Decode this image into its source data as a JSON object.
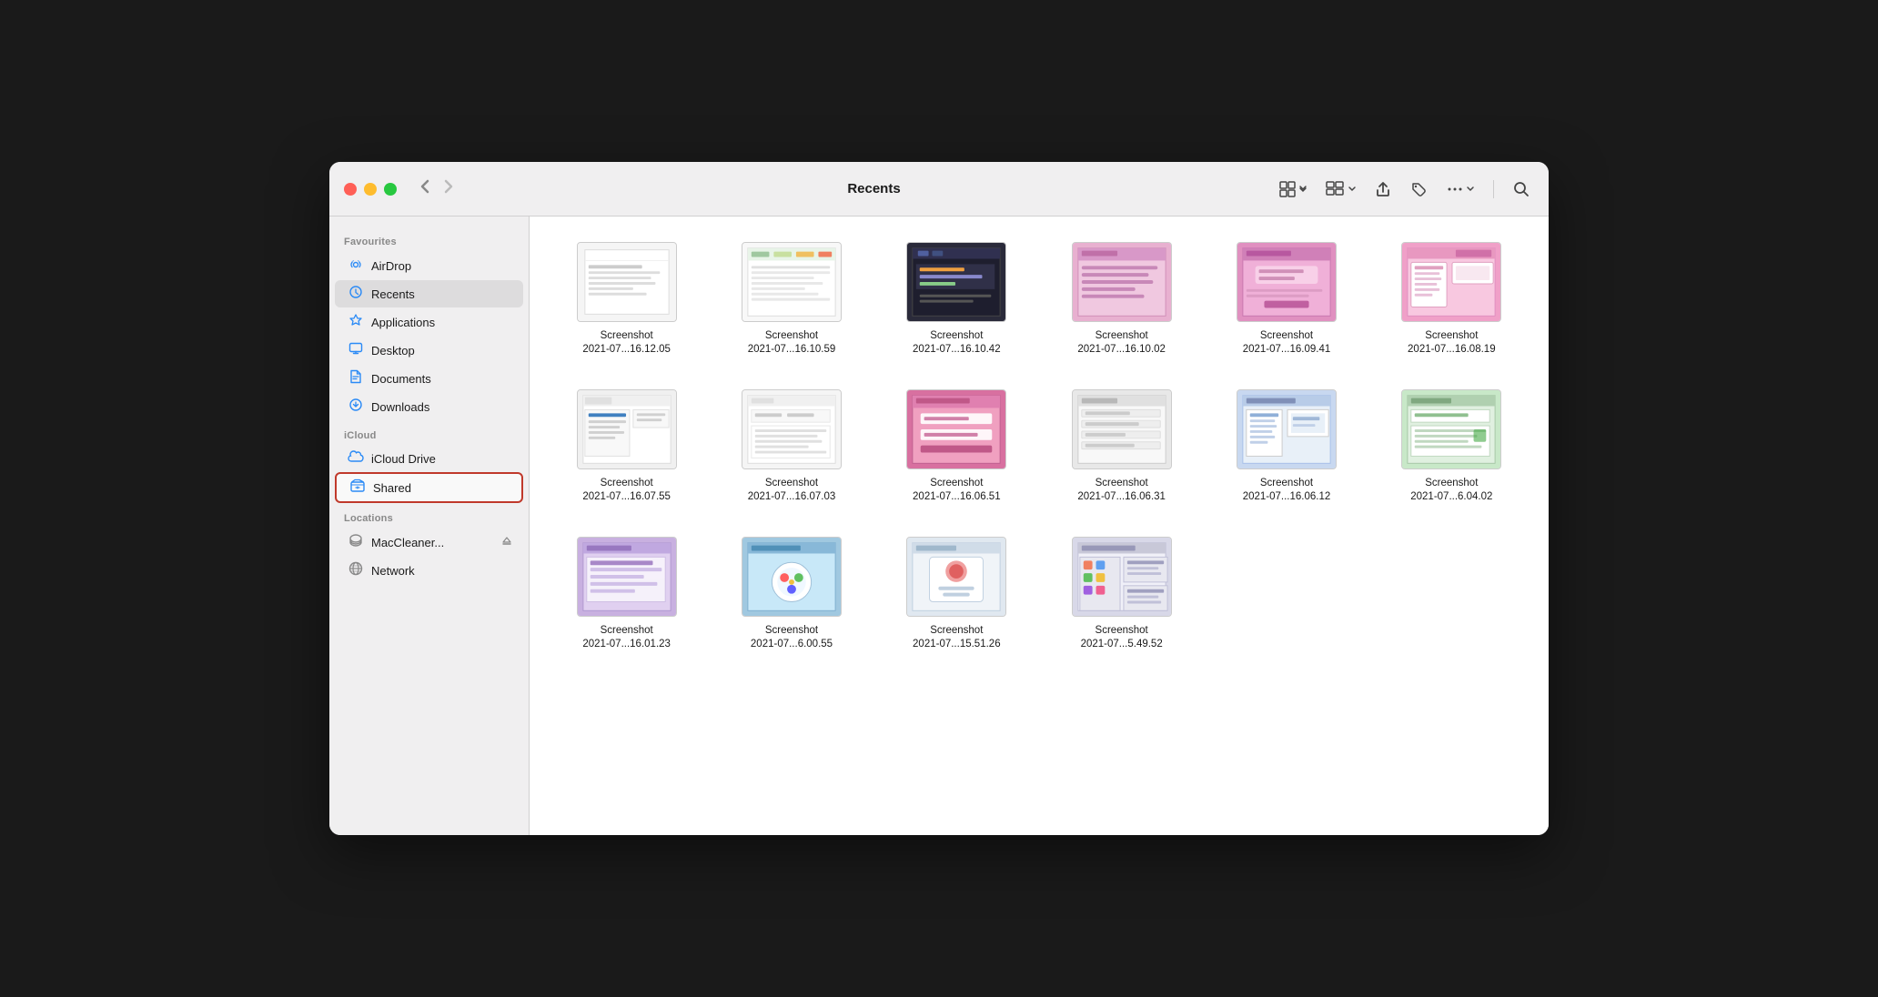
{
  "window": {
    "title": "Recents"
  },
  "toolbar": {
    "back_label": "‹",
    "forward_label": "›",
    "view_grid_label": "⊞",
    "view_options_label": "⊟",
    "share_label": "↑",
    "tag_label": "◇",
    "more_label": "•••",
    "search_label": "⌕"
  },
  "sidebar": {
    "favourites_header": "Favourites",
    "icloud_header": "iCloud",
    "locations_header": "Locations",
    "items": [
      {
        "id": "airdrop",
        "label": "AirDrop",
        "icon": "📡",
        "active": false
      },
      {
        "id": "recents",
        "label": "Recents",
        "icon": "🕐",
        "active": true
      },
      {
        "id": "applications",
        "label": "Applications",
        "icon": "🚀",
        "active": false
      },
      {
        "id": "desktop",
        "label": "Desktop",
        "icon": "🖥",
        "active": false
      },
      {
        "id": "documents",
        "label": "Documents",
        "icon": "📄",
        "active": false
      },
      {
        "id": "downloads",
        "label": "Downloads",
        "icon": "⬇",
        "active": false
      }
    ],
    "icloud_items": [
      {
        "id": "icloud-drive",
        "label": "iCloud Drive",
        "icon": "☁",
        "active": false
      },
      {
        "id": "shared",
        "label": "Shared",
        "icon": "📁",
        "active": false,
        "selected": true
      }
    ],
    "location_items": [
      {
        "id": "maccleaner",
        "label": "MacCleaner...",
        "icon": "💽",
        "active": false,
        "eject": true
      },
      {
        "id": "network",
        "label": "Network",
        "icon": "🌐",
        "active": false
      }
    ]
  },
  "files": [
    {
      "id": 1,
      "name": "Screenshot",
      "date": "2021-07...16.12.05",
      "thumb_type": "light"
    },
    {
      "id": 2,
      "name": "Screenshot",
      "date": "2021-07...16.10.59",
      "thumb_type": "colorful"
    },
    {
      "id": 3,
      "name": "Screenshot",
      "date": "2021-07...16.10.42",
      "thumb_type": "dark"
    },
    {
      "id": 4,
      "name": "Screenshot",
      "date": "2021-07...16.10.02",
      "thumb_type": "pink"
    },
    {
      "id": 5,
      "name": "Screenshot",
      "date": "2021-07...16.09.41",
      "thumb_type": "pink2"
    },
    {
      "id": 6,
      "name": "Screenshot",
      "date": "2021-07...16.08.19",
      "thumb_type": "pink3"
    },
    {
      "id": 7,
      "name": "Screenshot",
      "date": "2021-07...16.07.55",
      "thumb_type": "light2"
    },
    {
      "id": 8,
      "name": "Screenshot",
      "date": "2021-07...16.07.03",
      "thumb_type": "light3"
    },
    {
      "id": 9,
      "name": "Screenshot",
      "date": "2021-07...16.06.51",
      "thumb_type": "pink4"
    },
    {
      "id": 10,
      "name": "Screenshot",
      "date": "2021-07...16.06.31",
      "thumb_type": "gray"
    },
    {
      "id": 11,
      "name": "Screenshot",
      "date": "2021-07...16.06.12",
      "thumb_type": "blue"
    },
    {
      "id": 12,
      "name": "Screenshot",
      "date": "2021-07...6.04.02",
      "thumb_type": "green"
    },
    {
      "id": 13,
      "name": "Screenshot",
      "date": "2021-07...16.01.23",
      "thumb_type": "purple"
    },
    {
      "id": 14,
      "name": "Screenshot",
      "date": "2021-07...6.00.55",
      "thumb_type": "colorful2"
    },
    {
      "id": 15,
      "name": "Screenshot",
      "date": "2021-07...15.51.26",
      "thumb_type": "light4"
    },
    {
      "id": 16,
      "name": "Screenshot",
      "date": "2021-07...5.49.52",
      "thumb_type": "icons"
    }
  ]
}
